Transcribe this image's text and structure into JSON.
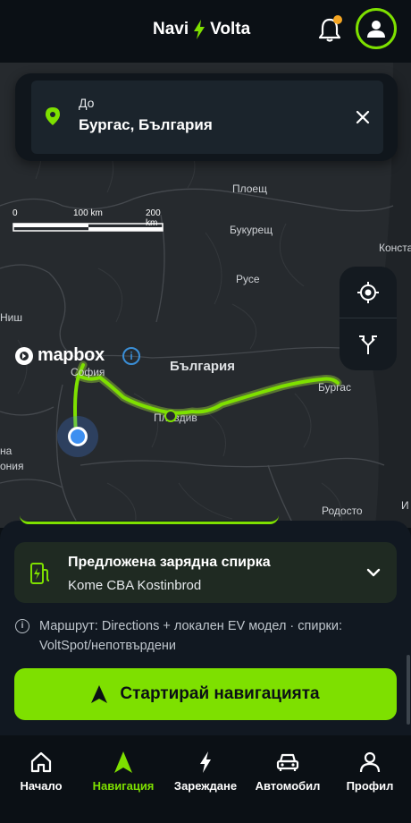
{
  "header": {
    "brand_left": "Navi",
    "brand_right": "Volta",
    "icons": [
      "bolt-icon",
      "bell-icon",
      "user-icon"
    ],
    "colors": {
      "accent": "#7ee000",
      "notification": "#f5a623",
      "background": "#0b1015"
    }
  },
  "destination": {
    "label": "До",
    "value": "Бургас, България"
  },
  "map": {
    "scale": {
      "labels": [
        "0",
        "100 km",
        "200 km"
      ]
    },
    "attribution": "mapbox",
    "attribution_info": "i",
    "labels": {
      "ploesti": "Плоещ",
      "bucharest": "Букурещ",
      "constanta": "Конста",
      "ruse": "Русе",
      "nish": "Ниш",
      "sofia": "София",
      "bulgaria": "България",
      "burgas": "Бургас",
      "plovdiv": "Пловдив",
      "rhodope": "Родосто",
      "i_edge": "И",
      "edge_ma": "на",
      "edge_nia": "ония"
    },
    "route_color": "#7ee000"
  },
  "suggestion": {
    "title": "Предложена зарядна спирка",
    "subtitle": "Kome CBA Kostinbrod"
  },
  "route_info": {
    "icon": "i",
    "text": "Маршрут: Directions + локален EV модел · спирки: VoltSpot/непотвърдени"
  },
  "start_button": {
    "label": "Стартирай навигацията"
  },
  "bottom_nav": {
    "items": [
      {
        "label": "Начало",
        "icon": "home-icon"
      },
      {
        "label": "Навигация",
        "icon": "navigation-icon",
        "active": true
      },
      {
        "label": "Зареждане",
        "icon": "bolt-icon"
      },
      {
        "label": "Автомобил",
        "icon": "car-icon"
      },
      {
        "label": "Профил",
        "icon": "person-icon"
      }
    ]
  }
}
